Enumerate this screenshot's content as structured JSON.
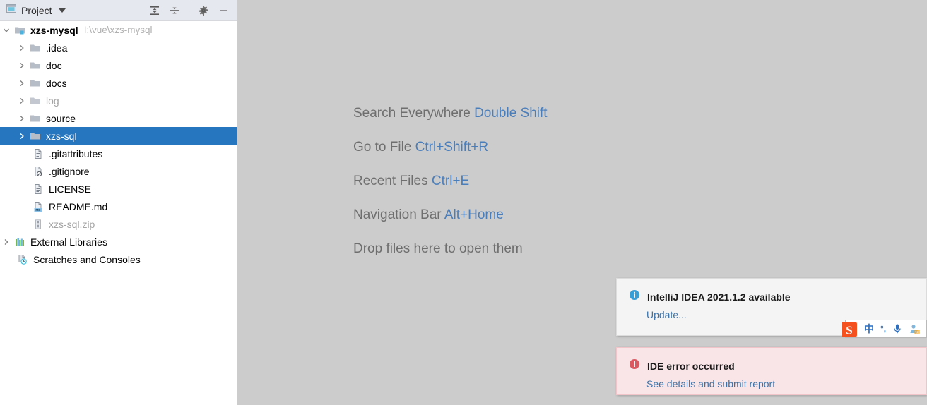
{
  "tool_window": {
    "title": "Project",
    "icon": "project-window-icon",
    "actions": [
      {
        "name": "expand-all",
        "label": "Expand All"
      },
      {
        "name": "collapse-all",
        "label": "Collapse All"
      },
      {
        "name": "settings",
        "label": "Settings"
      },
      {
        "name": "hide",
        "label": "Hide"
      }
    ]
  },
  "tree": {
    "root": {
      "label": "xzs-mysql",
      "path": "I:\\vue\\xzs-mysql",
      "icon": "module-folder-icon",
      "expanded": true
    },
    "items": [
      {
        "label": ".idea",
        "icon": "folder-icon",
        "indent": 1,
        "arrow": "collapsed",
        "muted": false,
        "selected": false
      },
      {
        "label": "doc",
        "icon": "folder-icon",
        "indent": 1,
        "arrow": "collapsed",
        "muted": false,
        "selected": false
      },
      {
        "label": "docs",
        "icon": "folder-icon",
        "indent": 1,
        "arrow": "collapsed",
        "muted": false,
        "selected": false
      },
      {
        "label": "log",
        "icon": "folder-icon",
        "indent": 1,
        "arrow": "collapsed",
        "muted": true,
        "selected": false
      },
      {
        "label": "source",
        "icon": "folder-icon",
        "indent": 1,
        "arrow": "collapsed",
        "muted": false,
        "selected": false
      },
      {
        "label": "xzs-sql",
        "icon": "folder-icon",
        "indent": 1,
        "arrow": "collapsed",
        "muted": false,
        "selected": true
      },
      {
        "label": ".gitattributes",
        "icon": "text-file-icon",
        "indent": 2,
        "arrow": "none",
        "muted": false,
        "selected": false
      },
      {
        "label": ".gitignore",
        "icon": "gitignore-file-icon",
        "indent": 2,
        "arrow": "none",
        "muted": false,
        "selected": false
      },
      {
        "label": "LICENSE",
        "icon": "text-file-icon",
        "indent": 2,
        "arrow": "none",
        "muted": false,
        "selected": false
      },
      {
        "label": "README.md",
        "icon": "markdown-file-icon",
        "indent": 2,
        "arrow": "none",
        "muted": false,
        "selected": false
      },
      {
        "label": "xzs-sql.zip",
        "icon": "archive-file-icon",
        "indent": 2,
        "arrow": "none",
        "muted": true,
        "selected": false
      },
      {
        "label": "External Libraries",
        "icon": "libraries-icon",
        "indent": 0,
        "arrow": "collapsed",
        "muted": false,
        "selected": false
      },
      {
        "label": "Scratches and Consoles",
        "icon": "scratches-icon",
        "indent": 1,
        "arrow": "none",
        "muted": false,
        "selected": false
      }
    ]
  },
  "editor_hints": [
    {
      "action": "Search Everywhere",
      "shortcut": "Double Shift"
    },
    {
      "action": "Go to File",
      "shortcut": "Ctrl+Shift+R"
    },
    {
      "action": "Recent Files",
      "shortcut": "Ctrl+E"
    },
    {
      "action": "Navigation Bar",
      "shortcut": "Alt+Home"
    },
    {
      "action": "Drop files here to open them",
      "shortcut": ""
    }
  ],
  "notifications": [
    {
      "name": "update-available",
      "severity": "info",
      "icon": "info-icon",
      "title": "IntelliJ IDEA 2021.1.2 available",
      "link": "Update..."
    },
    {
      "name": "ide-error",
      "severity": "error",
      "icon": "error-icon",
      "title": "IDE error occurred",
      "link": "See details and submit report"
    }
  ],
  "ime_bar": {
    "logo": "sogou-logo-icon",
    "items": [
      {
        "name": "language-mode",
        "glyph": "中"
      },
      {
        "name": "punctuation-mode",
        "glyph": "°,"
      },
      {
        "name": "voice-input",
        "glyph": "mic-icon"
      },
      {
        "name": "toolbox",
        "glyph": "toolbox-icon",
        "badge": "12"
      }
    ]
  },
  "colors": {
    "selection": "#2675bf",
    "link": "#3b72a8",
    "hint_text": "#6e6e6e",
    "hint_shortcut": "#4a7ebb",
    "editor_bg": "#cccccc",
    "header_bg": "#e6e8ef",
    "error_bg": "#f9e5e7",
    "info_bg": "#f4f4f4"
  }
}
